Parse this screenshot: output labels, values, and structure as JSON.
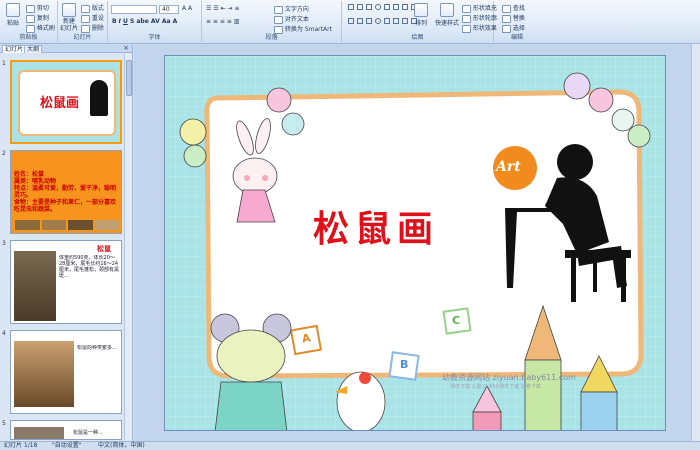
{
  "ribbon": {
    "clipboard": {
      "paste": "粘贴",
      "cut": "剪切",
      "copy": "复制",
      "format_painter": "格式刷",
      "label": "剪贴板"
    },
    "slides": {
      "new_slide": "新建\n幻灯片",
      "layout": "版式",
      "reset": "重设",
      "delete": "删除",
      "label": "幻灯片"
    },
    "font": {
      "size": "40",
      "label": "字体"
    },
    "paragraph": {
      "text_direction": "文字方向",
      "align_text": "对齐文本",
      "smartart": "转换为 SmartArt",
      "label": "段落"
    },
    "drawing": {
      "arrange": "排列",
      "quick_styles": "快速样式",
      "shape_fill": "形状填充",
      "shape_outline": "形状轮廓",
      "shape_effects": "形状效果",
      "label": "绘图"
    },
    "editing": {
      "find": "查找",
      "replace": "替换",
      "select": "选择",
      "label": "编辑"
    }
  },
  "left_pane": {
    "tabs": [
      "幻灯片",
      "大纲"
    ],
    "close": "×",
    "slides": [
      {
        "num": "1",
        "title": "松鼠画"
      },
      {
        "num": "2",
        "lines": [
          "姓名：松鼠",
          "属类：哺乳动物",
          "特点：温柔可爱，勤劳，爱干净，聪明灵巧。",
          "食物：主要是种子和果仁，一部分喜欢吃昆虫和蔬菜。"
        ]
      },
      {
        "num": "3",
        "title": "松鼠",
        "text": "体重约590克，体长20～28厘米，尾毛长约16～24厘米，尾毛蓬松，颈部有黑斑..."
      },
      {
        "num": "4",
        "text": "松鼠的种类繁多..."
      },
      {
        "num": "5",
        "text": "松鼠是一种..."
      }
    ]
  },
  "slide": {
    "title": "松鼠画",
    "art": "Art",
    "watermark1": "幼教资源网站 ziyuan.baby611.com",
    "watermark2": "课件下载  儿歌  FLASH课件下载  试卷下载",
    "blocks": [
      "A",
      "B",
      "C"
    ]
  },
  "status": {
    "slide_info": "幻灯片 1/18",
    "theme": "\"自动设置\"",
    "lang": "中文(简体，中国)"
  },
  "colors": {
    "title_red": "#e0101a",
    "slide_bg": "#a9e3e6",
    "frame": "#f0b878"
  }
}
